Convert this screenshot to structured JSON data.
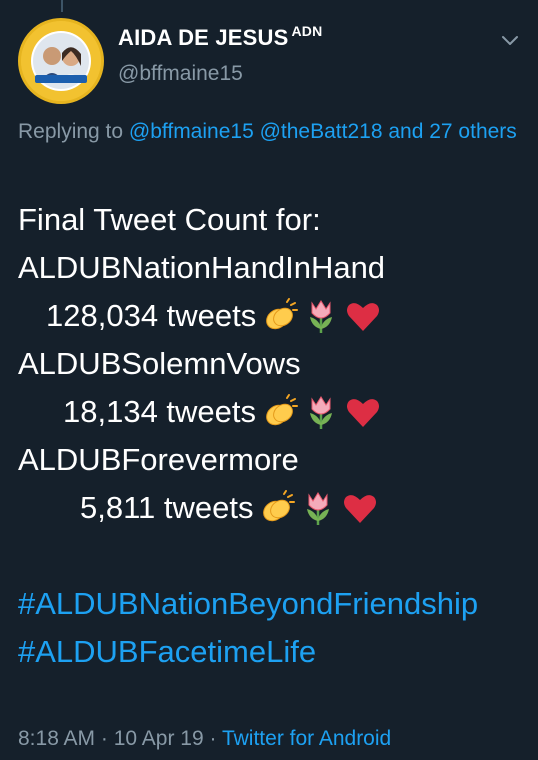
{
  "tweet": {
    "author_name": "AIDA DE JESUS",
    "author_badge": "ADN",
    "author_handle": "@bffmaine15",
    "avatar_icon": "profile-avatar",
    "replying_prefix": "Replying to",
    "reply_handle_1": "@bffmaine15",
    "reply_handle_2": "@theBatt218",
    "reply_and": "and",
    "reply_others": "27 others",
    "heading": "Final Tweet Count for:",
    "tags": [
      {
        "name": "ALDUBNationHandInHand",
        "count": "128,034 tweets"
      },
      {
        "name": "ALDUBSolemnVows",
        "count": "18,134 tweets"
      },
      {
        "name": "ALDUBForevermore",
        "count": "5,811 tweets"
      }
    ],
    "emojis": [
      "clapping-hands",
      "tulip",
      "red-heart"
    ],
    "hashtag_1": "#ALDUBNationBeyondFriendship",
    "hashtag_2": "#ALDUBFacetimeLife",
    "time": "8:18 AM",
    "separator": "·",
    "date": "10 Apr 19",
    "source": "Twitter for Android"
  },
  "colors": {
    "background": "#15202b",
    "text": "#ffffff",
    "muted": "#8899a6",
    "link": "#1da1f2",
    "heart": "#e0245e"
  }
}
